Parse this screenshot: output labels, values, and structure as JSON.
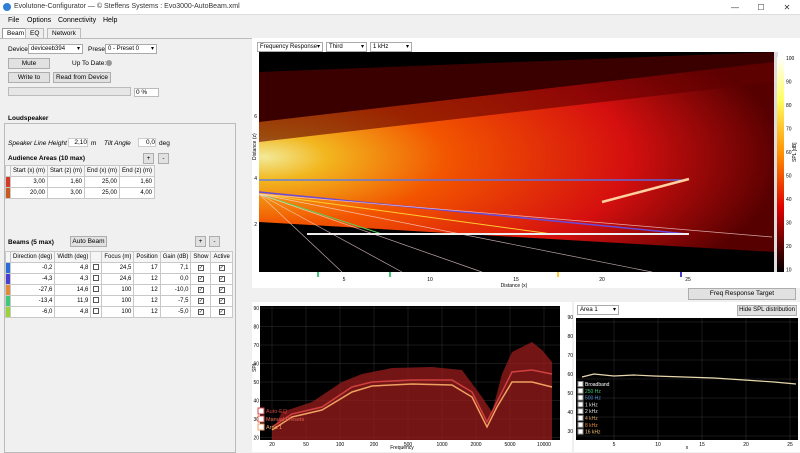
{
  "window": {
    "title": "Evolutone-Configurator — © Steffens Systems : Evo3000-AutoBeam.xml",
    "minimize": "—",
    "maximize": "☐",
    "close": "✕"
  },
  "menu": [
    "File",
    "Options",
    "Connectivity",
    "Help"
  ],
  "tabs": [
    "Beam",
    "EQ",
    "Network"
  ],
  "device": {
    "label": "Device",
    "value": "deviceeb394",
    "preset_label": "Preset",
    "preset_value": "0 - Preset 0"
  },
  "mute": {
    "label": "Mute"
  },
  "up_to_date": {
    "label": "Up To Date:"
  },
  "write": {
    "label": "Write to"
  },
  "read": {
    "label": "Read from Device"
  },
  "progress": {
    "percent": 0,
    "label": "0 %"
  },
  "loudspeaker": {
    "title": "Loudspeaker",
    "height_label": "Speaker Line Height",
    "height_value": "2,10",
    "height_unit": "m",
    "tilt_label": "Tilt Angle",
    "tilt_value": "0,0",
    "tilt_unit": "deg"
  },
  "audience": {
    "title": "Audience Areas (10 max)",
    "add": "+",
    "remove": "-",
    "headers": [
      "Start (x) (m)",
      "Start (z) (m)",
      "End (x) (m)",
      "End (z) (m)"
    ],
    "rows": [
      {
        "color": "#d43a2a",
        "values": [
          "3,00",
          "1,60",
          "25,00",
          "1,60"
        ]
      },
      {
        "color": "#c85a20",
        "values": [
          "20,00",
          "3,00",
          "25,00",
          "4,00"
        ]
      }
    ]
  },
  "beams": {
    "title": "Beams (5 max)",
    "auto_beam": "Auto Beam",
    "add": "+",
    "remove": "-",
    "headers": [
      "Direction (deg)",
      "Width (deg)",
      "",
      "Focus (m)",
      "Position",
      "Gain (dB)",
      "Show",
      "Active"
    ],
    "rows": [
      {
        "color": "#2b6fd6",
        "direction": "-0,2",
        "width": "4,8",
        "focus": "24,5",
        "position": "17",
        "gain": "7,1"
      },
      {
        "color": "#4a3fd0",
        "direction": "-4,3",
        "width": "4,3",
        "focus": "24,6",
        "position": "12",
        "gain": "0,0"
      },
      {
        "color": "#e08a3a",
        "direction": "-27,6",
        "width": "14,6",
        "focus": "100",
        "position": "12",
        "gain": "-10,0"
      },
      {
        "color": "#3fc77a",
        "direction": "-13,4",
        "width": "11,9",
        "focus": "100",
        "position": "12",
        "gain": "-7,5"
      },
      {
        "color": "#9ad23a",
        "direction": "-6,0",
        "width": "4,8",
        "focus": "100",
        "position": "12",
        "gain": "-5,0"
      }
    ]
  },
  "heatmap": {
    "mode": "Frequency Response",
    "band": "Third",
    "freq": "1 kHz",
    "ylabel": "Distance (z)",
    "xlabel": "Distance (x)",
    "colorbar_label": "SPL [dB]",
    "yticks": [
      "6",
      "4",
      "2"
    ],
    "xticks": [
      "5",
      "10",
      "15",
      "20",
      "25"
    ],
    "cticks": [
      "100",
      "90",
      "80",
      "70",
      "60",
      "50",
      "40",
      "30",
      "20",
      "10"
    ]
  },
  "freq_target": {
    "label": "Freq Response Target"
  },
  "spl_chart": {
    "ylabel": "SPL",
    "xlabel": "Frequency",
    "yticks": [
      "90",
      "80",
      "70",
      "60",
      "50",
      "40",
      "30",
      "20"
    ],
    "xticks": [
      "20",
      "50",
      "100",
      "200",
      "500",
      "1000",
      "2000",
      "5000",
      "10000"
    ],
    "legend": [
      "Auto-EQ",
      "Manual Presets",
      "Area 1"
    ]
  },
  "area_chart": {
    "area": "Area 1",
    "hide_label": "Hide SPL distribution",
    "ylabel": "SPL",
    "xlabel": "x",
    "yticks": [
      "90",
      "80",
      "70",
      "60",
      "50",
      "40",
      "30"
    ],
    "xticks": [
      "5",
      "10",
      "15",
      "20",
      "25"
    ],
    "legend": [
      "Broadband",
      "250 Hz",
      "500 Hz",
      "1 kHz",
      "2 kHz",
      "4 kHz",
      "8 kHz",
      "16 kHz"
    ]
  }
}
